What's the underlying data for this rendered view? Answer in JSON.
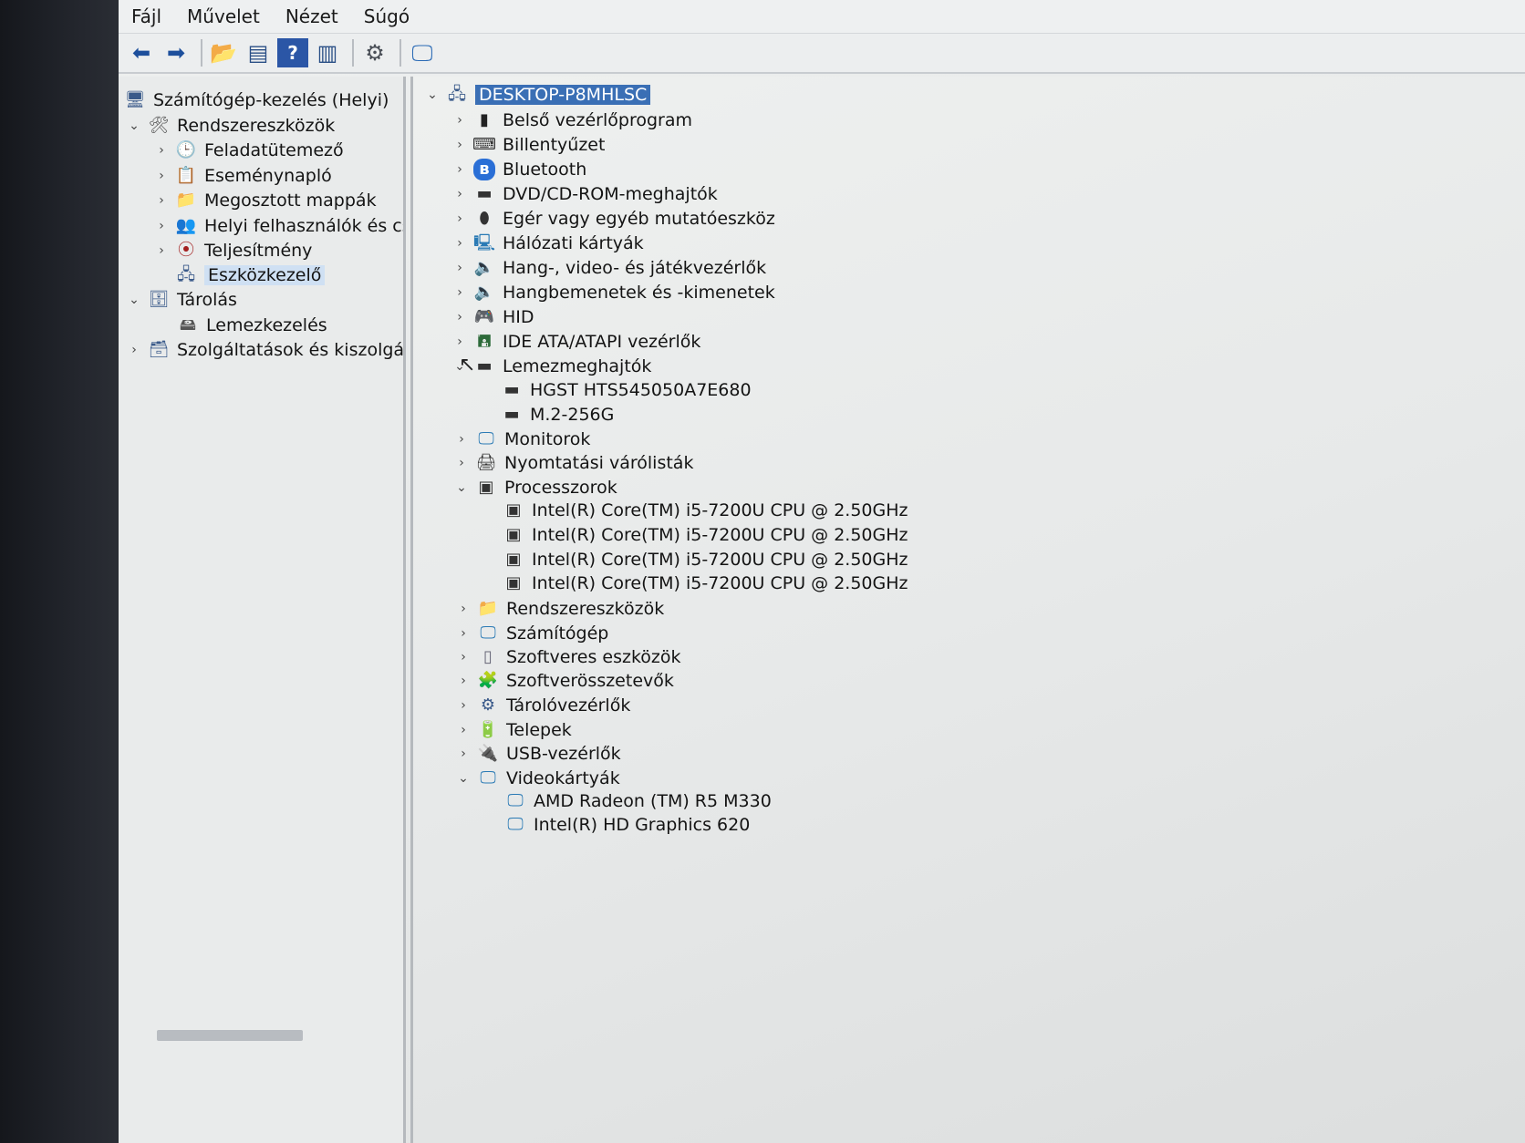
{
  "menu": [
    "Fájl",
    "Művelet",
    "Nézet",
    "Súgó"
  ],
  "toolbar": {
    "buttons": [
      "back-arrow-icon",
      "forward-arrow-icon",
      "folder-up-icon",
      "show-hide-console-tree-icon",
      "help-icon",
      "action-pane-icon",
      "update-driver-icon",
      "scan-hardware-icon"
    ]
  },
  "left_tree": {
    "root": "Számítógép-kezelés (Helyi)",
    "system_tools": "Rendszereszközök",
    "task_scheduler": "Feladatütemező",
    "event_viewer": "Eseménynapló",
    "shared_folders": "Megosztott mappák",
    "local_users": "Helyi felhasználók és csc",
    "performance": "Teljesítmény",
    "device_manager": "Eszközkezelő",
    "storage": "Tárolás",
    "disk_management": "Lemezkezelés",
    "services": "Szolgáltatások és kiszolgáló"
  },
  "device_tree": {
    "computer": "DESKTOP-P8MHLSC",
    "categories": [
      "Belső vezérlőprogram",
      "Billentyűzet",
      "Bluetooth",
      "DVD/CD-ROM-meghajtók",
      "Egér vagy egyéb mutatóeszköz",
      "Hálózati kártyák",
      "Hang-, video- és játékvezérlők",
      "Hangbemenetek és -kimenetek",
      "HID",
      "IDE ATA/ATAPI vezérlők",
      "Lemezmeghajtók"
    ],
    "disks": [
      "HGST HTS545050A7E680",
      "M.2-256G"
    ],
    "categories2": [
      "Monitorok",
      "Nyomtatási várólisták",
      "Processzorok"
    ],
    "cpus": [
      "Intel(R) Core(TM) i5-7200U CPU @ 2.50GHz",
      "Intel(R) Core(TM) i5-7200U CPU @ 2.50GHz",
      "Intel(R) Core(TM) i5-7200U CPU @ 2.50GHz",
      "Intel(R) Core(TM) i5-7200U CPU @ 2.50GHz"
    ],
    "categories3": [
      "Rendszereszközök",
      "Számítógép",
      "Szoftveres eszközök",
      "Szoftverösszetevők",
      "Tárolóvezérlők",
      "Telepek",
      "USB-vezérlők",
      "Videokártyák"
    ],
    "gpus": [
      "AMD Radeon (TM) R5 M330",
      "Intel(R) HD Graphics 620"
    ]
  }
}
